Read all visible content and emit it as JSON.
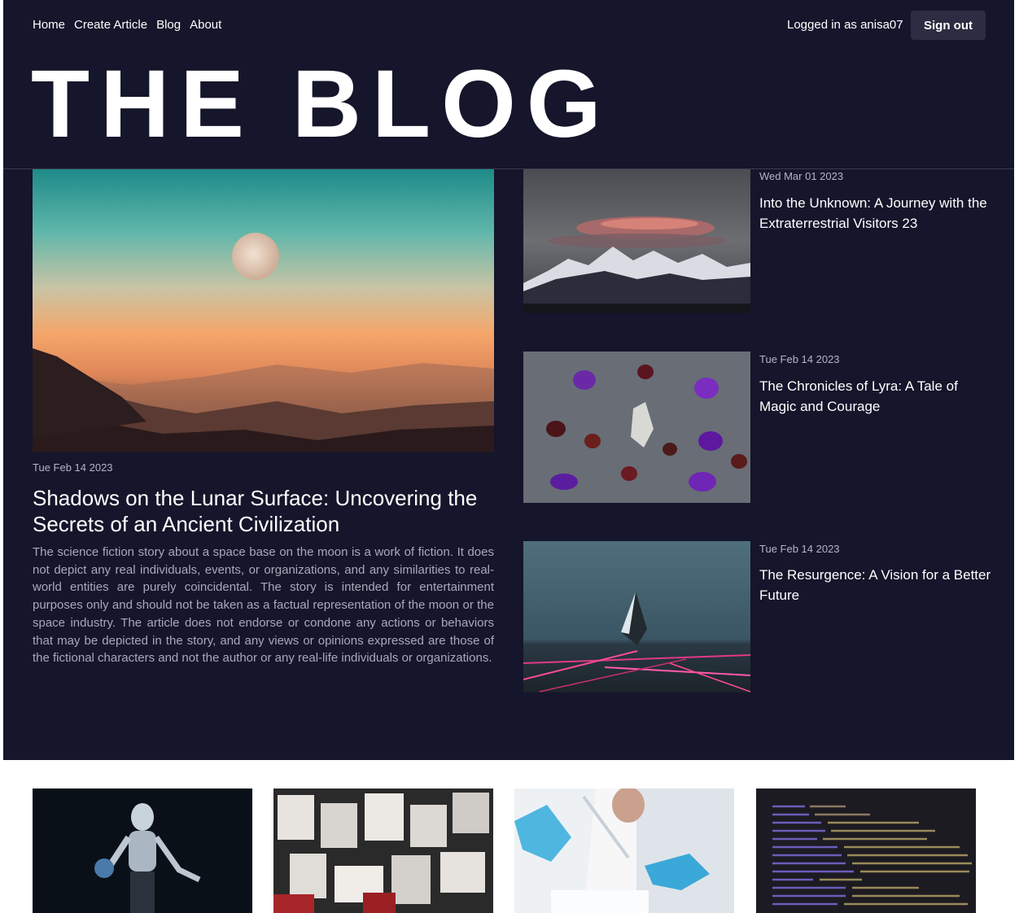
{
  "nav": {
    "items": [
      {
        "label": "Home"
      },
      {
        "label": "Create Article"
      },
      {
        "label": "Blog"
      },
      {
        "label": "About"
      }
    ],
    "user_label": "Logged in as anisa07",
    "sign_out_label": "Sign out"
  },
  "header": {
    "title": "THE BLOG"
  },
  "featured": {
    "date": "Tue Feb 14 2023",
    "title": "Shadows on the Lunar Surface: Uncovering the Secrets of an Ancient Civilization",
    "body": "The science fiction story about a space base on the moon is a work of fiction. It does not depict any real individuals, events, or organizations, and any similarities to real-world entities are purely coincidental. The story is intended for entertainment purposes only and should not be taken as a factual representation of the moon or the space industry. The article does not endorse or condone any actions or behaviors that may be depicted in the story, and any views or opinions expressed are those of the fictional characters and not the author or any real-life individuals or organizations."
  },
  "side_articles": [
    {
      "date": "Wed Mar 01 2023",
      "title": "Into the Unknown: A Journey with the Extraterrestrial Visitors 23"
    },
    {
      "date": "Tue Feb 14 2023",
      "title": "The Chronicles of Lyra: A Tale of Magic and Courage"
    },
    {
      "date": "Tue Feb 14 2023",
      "title": "The Resurgence: A Vision for a Better Future"
    }
  ],
  "colors": {
    "header_bg": "#15152b",
    "sign_out_bg": "#2c2c42",
    "muted_text": "#a9a9ba"
  }
}
